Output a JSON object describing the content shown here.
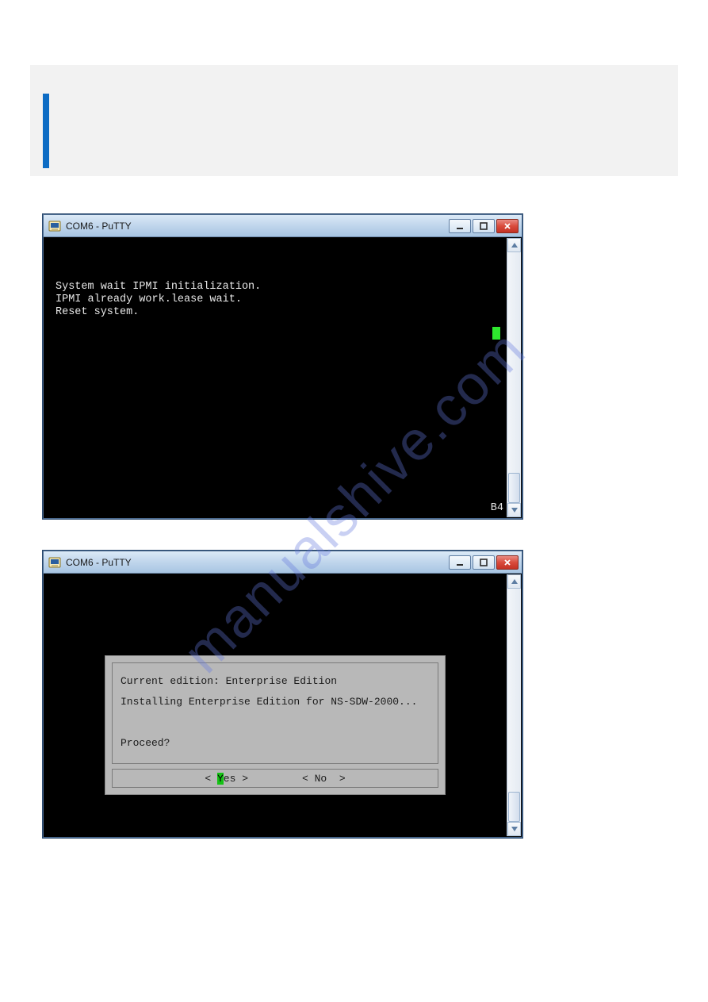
{
  "watermark": "manualshive.com",
  "window1": {
    "title": "COM6 - PuTTY",
    "lines": {
      "l1": "System wait IPMI initialization.",
      "l2": "IPMI already work.lease wait.",
      "l3": "Reset system."
    },
    "corner": "B4"
  },
  "window2": {
    "title": "COM6 - PuTTY",
    "dialog": {
      "line1": "Current edition: Enterprise Edition",
      "line2": "Installing Enterprise Edition for NS-SDW-2000...",
      "line3": "Proceed?",
      "yes_pre": "< ",
      "yes_sel": "Y",
      "yes_post": "es >",
      "no": "< No  >"
    }
  }
}
